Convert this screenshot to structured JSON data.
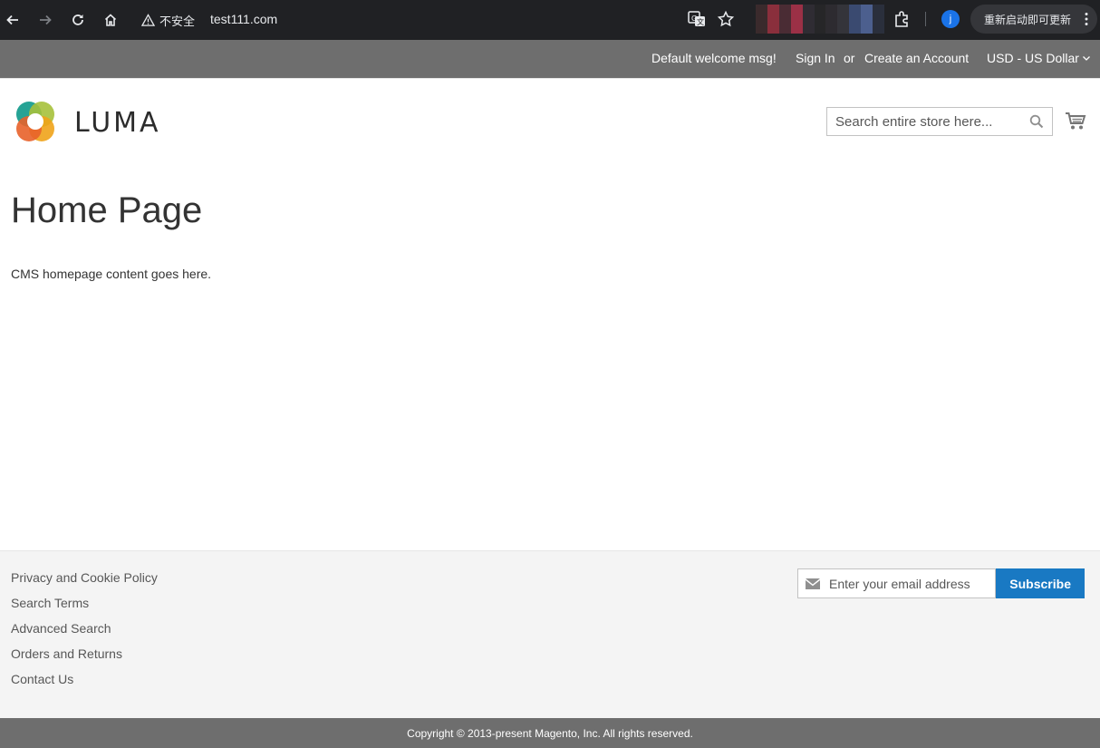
{
  "browser": {
    "security_label": "不安全",
    "url": "test111.com",
    "profile_initial": "j",
    "update_label": "重新启动即可更新",
    "extension_colors": [
      "#3a2a2c",
      "#8a2f3c",
      "#4a2c34",
      "#9b3046",
      "#2f2c33",
      "#262628",
      "#2d2b30",
      "#34343a",
      "#3a4a70",
      "#4c5f8e",
      "#2a2f3c"
    ]
  },
  "panel": {
    "welcome": "Default welcome msg!",
    "sign_in": "Sign In",
    "or": "or",
    "create_account": "Create an Account",
    "currency": "USD - US Dollar"
  },
  "header": {
    "logo_text": "LUMA",
    "search_placeholder": "Search entire store here..."
  },
  "main": {
    "title": "Home Page",
    "content": "CMS homepage content goes here."
  },
  "footer": {
    "links": [
      "Privacy and Cookie Policy",
      "Search Terms",
      "Advanced Search",
      "Orders and Returns",
      "Contact Us"
    ],
    "newsletter_placeholder": "Enter your email address",
    "subscribe_label": "Subscribe",
    "copyright": "Copyright © 2013-present Magento, Inc. All rights reserved."
  },
  "colors": {
    "panel_bg": "#6e6e6e",
    "accent": "#1979c3",
    "footer_bg": "#f4f4f4"
  }
}
